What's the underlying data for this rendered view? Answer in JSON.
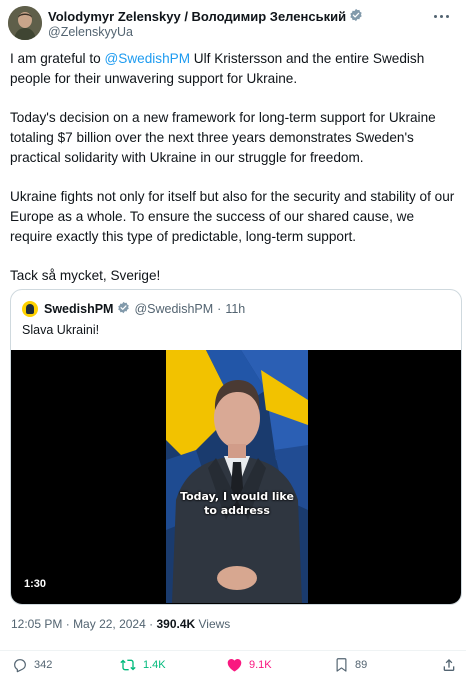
{
  "author": {
    "name": "Volodymyr Zelenskyy / Володимир Зеленський",
    "handle": "@ZelenskyyUa"
  },
  "tweet": {
    "intro": "I am grateful to ",
    "mention": "@SwedishPM",
    "intro_rest": " Ulf Kristersson and the entire Swedish people for their unwavering support for Ukraine.",
    "p2": "Today's decision on a new framework for long-term support for Ukraine totaling $7 billion over the next three years demonstrates Sweden's practical solidarity with Ukraine in our struggle for freedom.",
    "p3": "Ukraine fights not only for itself but also for the security and stability of our Europe as a whole. To ensure the success of our shared cause, we require exactly this type of predictable, long-term support.",
    "p4": "Tack så mycket, Sverige!"
  },
  "quote": {
    "name": "SwedishPM",
    "handle": "@SwedishPM",
    "separator": "·",
    "time": "11h",
    "text": "Slava Ukraini!",
    "caption_line1": "Today, I would like",
    "caption_line2": "to address",
    "duration": "1:30"
  },
  "meta": {
    "time": "12:05 PM",
    "separator": "·",
    "date": "May 22, 2024",
    "separator2": "·",
    "views_count": "390.4K",
    "views_label": " Views"
  },
  "actions": {
    "replies": "342",
    "reposts": "1.4K",
    "likes": "9.1K",
    "bookmarks": "89"
  },
  "colors": {
    "accent": "#1d9bf0",
    "repost": "#00ba7c",
    "like": "#f91880",
    "verified": "#829aab"
  },
  "icons": [
    "verified-icon",
    "more-icon",
    "reply-icon",
    "repost-icon",
    "like-icon",
    "bookmark-icon",
    "share-icon"
  ]
}
